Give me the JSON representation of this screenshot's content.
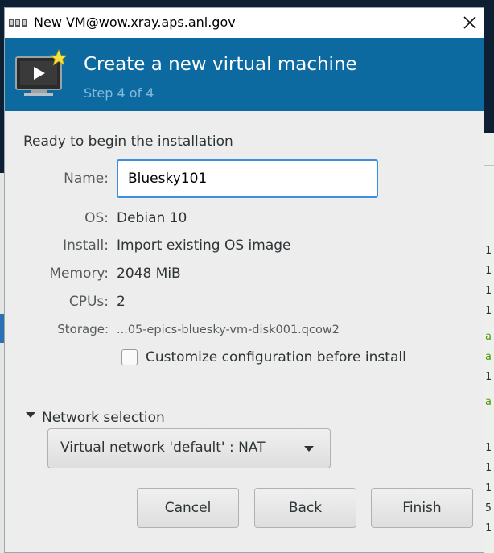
{
  "window": {
    "title": "New VM@wow.xray.aps.anl.gov"
  },
  "header": {
    "title": "Create a new virtual machine",
    "step": "Step 4 of 4"
  },
  "summary": {
    "ready_text": "Ready to begin the installation",
    "name_label": "Name:",
    "name_value": "Bluesky101",
    "os_label": "OS:",
    "os_value": "Debian 10",
    "install_label": "Install:",
    "install_value": "Import existing OS image",
    "memory_label": "Memory:",
    "memory_value": "2048 MiB",
    "cpus_label": "CPUs:",
    "cpus_value": "2",
    "storage_label": "Storage:",
    "storage_value": "...05-epics-bluesky-vm-disk001.qcow2",
    "customize_label": "Customize configuration before install",
    "customize_checked": false
  },
  "network": {
    "expander_label": "Network selection",
    "selected": "Virtual network 'default' : NAT"
  },
  "buttons": {
    "cancel": "Cancel",
    "back": "Back",
    "finish": "Finish"
  },
  "background_window": {
    "line_chars": [
      "1",
      "1",
      "1",
      "1",
      "a",
      "a",
      "1",
      "a",
      "1",
      "1",
      "1",
      "5",
      "1"
    ]
  },
  "colors": {
    "header_bg": "#0d6aa1",
    "header_step": "#83b9dc",
    "input_focus": "#3d8ee0",
    "desktop_bg": "#0d1f33"
  }
}
